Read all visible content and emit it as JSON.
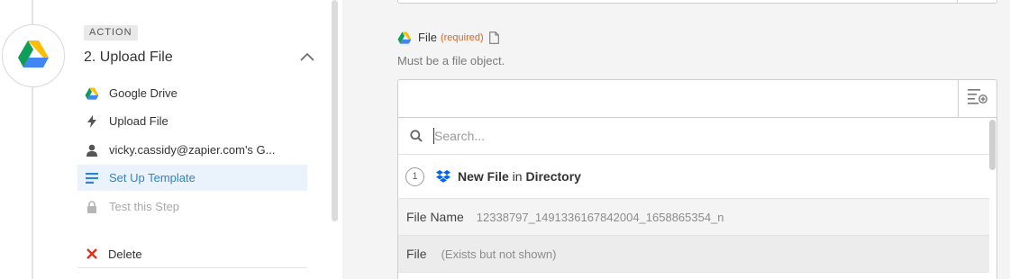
{
  "step": {
    "badge": "ACTION",
    "title": "2. Upload File",
    "app_icon": "google-drive-icon"
  },
  "menu": {
    "items": [
      {
        "label": "Google Drive",
        "icon": "google-drive-icon"
      },
      {
        "label": "Upload File",
        "icon": "bolt-icon"
      },
      {
        "label": "vicky.cassidy@zapier.com's G...",
        "icon": "person-icon"
      },
      {
        "label": "Set Up Template",
        "icon": "list-icon"
      },
      {
        "label": "Test this Step",
        "icon": "lock-icon"
      }
    ],
    "delete_label": "Delete"
  },
  "field": {
    "label": "File",
    "required_text": "(required)",
    "help": "Must be a file object."
  },
  "dropdown": {
    "search_placeholder": "Search...",
    "trigger": {
      "number": "1",
      "title_bold": "New File",
      "title_rest": " in ",
      "title_bold2": "Directory"
    },
    "rows": [
      {
        "key": "File Name",
        "value": "12338797_1491336167842004_1658865354_n"
      },
      {
        "key": "File",
        "value": "(Exists but not shown)"
      }
    ]
  },
  "colors": {
    "accent": "#2f83cf",
    "required": "#e8611c",
    "delete": "#e0301e"
  }
}
